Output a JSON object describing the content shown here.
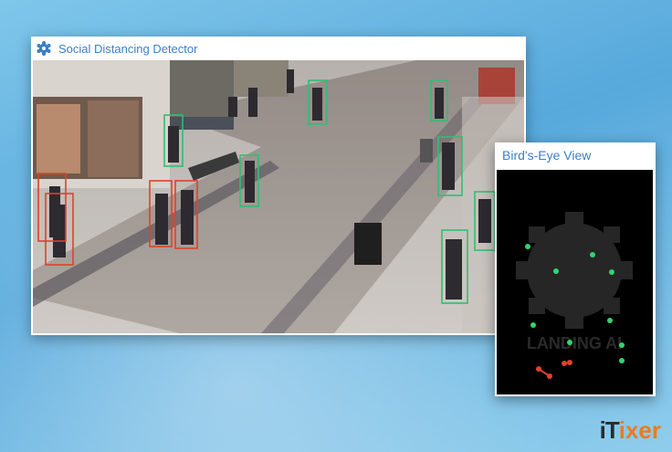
{
  "detector_window": {
    "title": "Social Distancing Detector",
    "icon": "gear-cog-icon",
    "colors": {
      "safe_box": "#2fbf71",
      "violation_box": "#e0412a",
      "title_text": "#3b7fc4"
    }
  },
  "birds_eye_window": {
    "title": "Bird's-Eye View",
    "logo_text": "LANDING AI",
    "colors": {
      "safe_point": "#2fd66f",
      "violation_point": "#e0412a",
      "background": "#000000"
    }
  },
  "watermark": {
    "part1": "iT",
    "part2": "ixer"
  }
}
